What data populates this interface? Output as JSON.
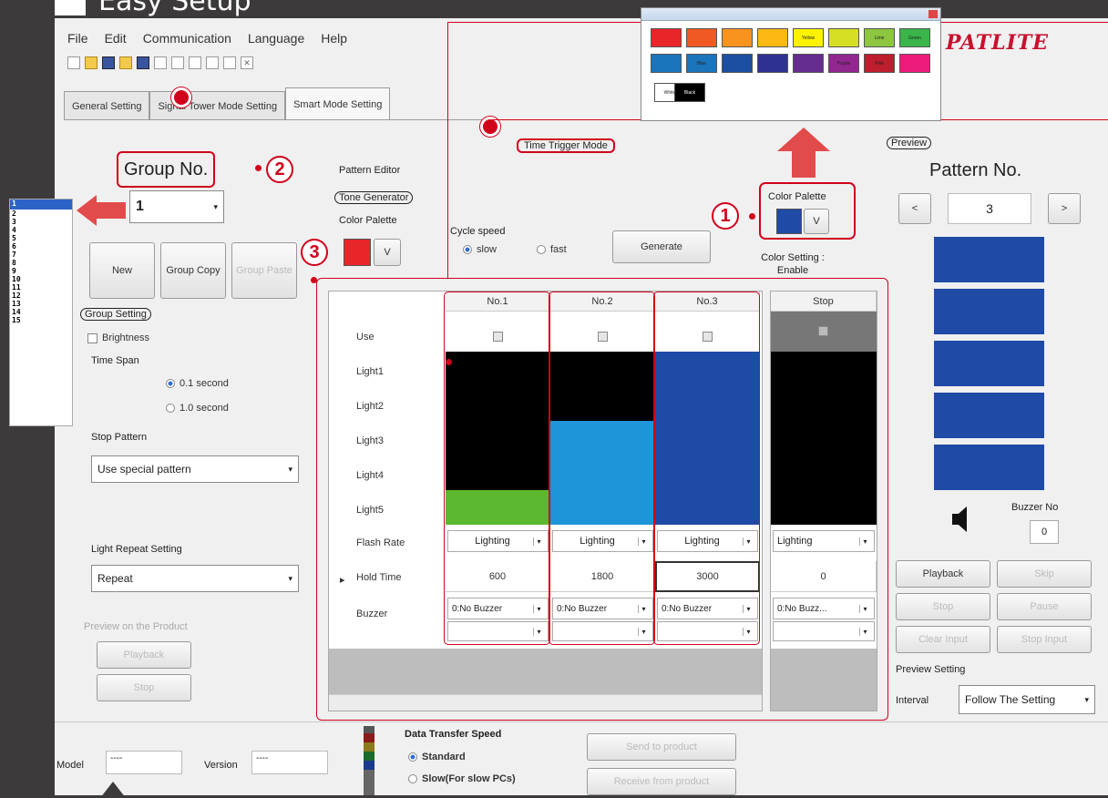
{
  "page_heading": "Easy Setup",
  "menu": [
    "File",
    "Edit",
    "Communication",
    "Language",
    "Help"
  ],
  "tabs": [
    "General Setting",
    "Signal Tower Mode Setting",
    "Smart Mode Setting"
  ],
  "logo": "PATLITE",
  "time_trigger_mode": "Time Trigger Mode",
  "preview_label": "Preview",
  "group_no_label": "Group No.",
  "group_no_value": "1",
  "group_list": [
    "1",
    "2",
    "3",
    "4",
    "5",
    "6",
    "7",
    "8",
    "9",
    "10",
    "11",
    "12",
    "13",
    "14",
    "15"
  ],
  "callouts": {
    "one": "1",
    "two": "2",
    "three": "3"
  },
  "buttons": {
    "new": "New",
    "group_copy": "Group Copy",
    "group_paste": "Group Paste",
    "generate": "Generate",
    "playback": "Playback",
    "skip": "Skip",
    "stop": "Stop",
    "pause": "Pause",
    "clear_input": "Clear Input",
    "stop_input": "Stop Input",
    "preview_playback": "Playback",
    "preview_stop": "Stop",
    "send": "Send to product",
    "receive": "Receive from product"
  },
  "pattern_editor": "Pattern Editor",
  "tone_generator": "Tone Generator",
  "color_palette_left": "Color Palette",
  "color_palette_right": "Color Palette",
  "v_button": "V",
  "cycle_speed": {
    "label": "Cycle speed",
    "slow": "slow",
    "fast": "fast"
  },
  "color_setting": "Color Setting : Enable",
  "group_setting": {
    "title": "Group Setting",
    "brightness": "Brightness",
    "time_span": "Time Span",
    "opt1": "0.1 second",
    "opt2": "1.0 second"
  },
  "stop_pattern": {
    "label": "Stop Pattern",
    "value": "Use special pattern"
  },
  "light_repeat": {
    "label": "Light Repeat Setting",
    "value": "Repeat"
  },
  "preview_on_product": "Preview on the Product",
  "table": {
    "columns": [
      "No.1",
      "No.2",
      "No.3"
    ],
    "stop_column": "Stop",
    "rows": [
      "Use",
      "Light1",
      "Light2",
      "Light3",
      "Light4",
      "Light5",
      "Flash Rate",
      "Hold Time",
      "Buzzer"
    ],
    "flash_rate": [
      "Lighting",
      "Lighting",
      "Lighting",
      "Lighting"
    ],
    "hold_time": [
      "600",
      "1800",
      "3000",
      "0"
    ],
    "buzzer": [
      "0:No Buzzer",
      "0:No Buzzer",
      "0:No Buzzer",
      "0:No Buzz..."
    ]
  },
  "light_colors": {
    "col1": [
      "#000000",
      "#000000",
      "#000000",
      "#000000",
      "#5cb82e"
    ],
    "col2": [
      "#000000",
      "#000000",
      "#1e95d9",
      "#1e95d9",
      "#1e95d9"
    ],
    "col3": [
      "#1f4aa6",
      "#1f4aa6",
      "#1f4aa6",
      "#1f4aa6",
      "#1f4aa6"
    ],
    "stop": [
      "#000000",
      "#000000",
      "#000000",
      "#000000",
      "#000000"
    ]
  },
  "preview": {
    "pattern_no_label": "Pattern No.",
    "pattern_no": "3",
    "prev": "<",
    "next": ">",
    "buzzer_label": "Buzzer No",
    "buzzer_no": "0",
    "bar_color": "#1f4aa6"
  },
  "preview_setting": {
    "label": "Preview Setting",
    "interval_label": "Interval",
    "interval_value": "Follow The Setting"
  },
  "data_transfer": {
    "title": "Data Transfer Speed",
    "standard": "Standard",
    "slow": "Slow(For slow PCs)"
  },
  "model_label": "Model",
  "model_value": "----",
  "version_label": "Version",
  "version_value": "----",
  "palette_swatch_labels": [
    "Yellow",
    "Lime",
    "Green",
    "Blue",
    "Purple",
    "Pink",
    "White",
    "Black"
  ],
  "palette_colors": [
    "#e8262a",
    "#f05a22",
    "#f7931e",
    "#fdb913",
    "#fff200",
    "#d7df23",
    "#8dc63f",
    "#39b54a",
    "#1b75bc",
    "#1c4fa1",
    "#2e3192",
    "#662d91",
    "#92278f",
    "#be1e2d",
    "#ed1c7a",
    "#ffffff",
    "#000000"
  ]
}
